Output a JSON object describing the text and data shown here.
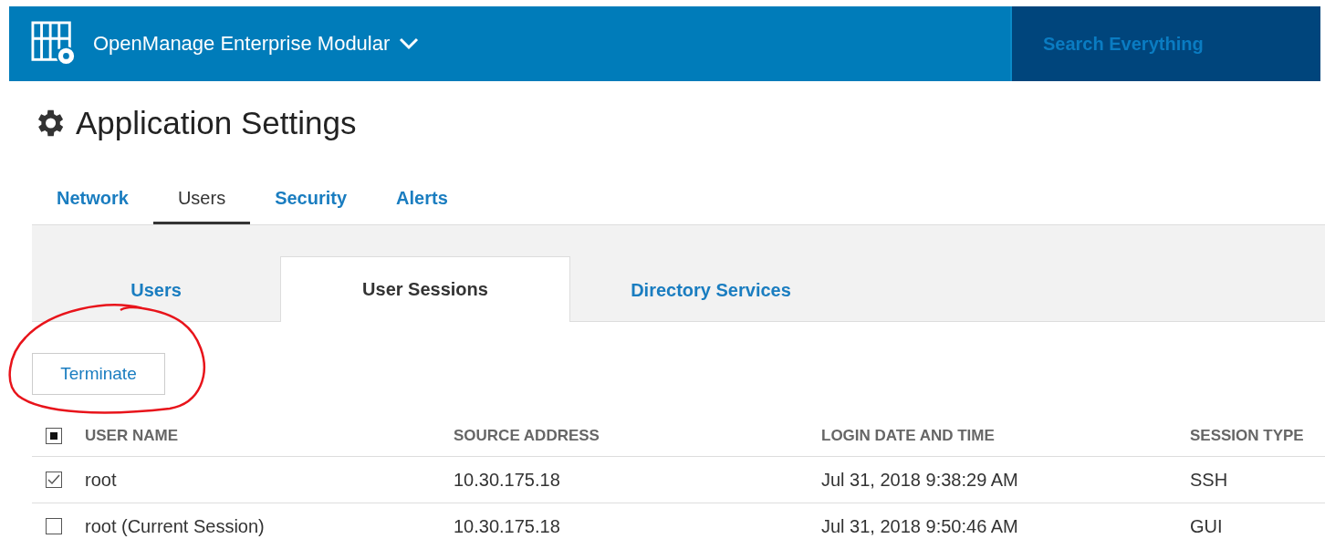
{
  "header": {
    "product": "OpenManage Enterprise Modular",
    "search": {
      "placeholder": "Search Everything"
    }
  },
  "page_title": "Application Settings",
  "tabs": [
    {
      "label": "Network",
      "selected": false
    },
    {
      "label": "Users",
      "selected": true
    },
    {
      "label": "Security",
      "selected": false
    },
    {
      "label": "Alerts",
      "selected": false
    }
  ],
  "subtabs": [
    {
      "label": "Users",
      "selected": false
    },
    {
      "label": "User Sessions",
      "selected": true
    },
    {
      "label": "Directory Services",
      "selected": false
    }
  ],
  "toolbar": {
    "buttons": [
      "Terminate"
    ]
  },
  "annotation": {
    "kind": "circle"
  },
  "table": {
    "select_all": {
      "indeterminate": true
    },
    "columns": [
      "USER NAME",
      "SOURCE ADDRESS",
      "LOGIN DATE AND TIME",
      "SESSION TYPE"
    ],
    "rows": [
      {
        "checked": true,
        "cells": [
          "root",
          "10.30.175.18",
          "Jul 31, 2018 9:38:29 AM",
          "SSH"
        ]
      },
      {
        "checked": false,
        "cells": [
          "root (Current Session)",
          "10.30.175.18",
          "Jul 31, 2018 9:50:46 AM",
          "GUI"
        ]
      }
    ]
  }
}
